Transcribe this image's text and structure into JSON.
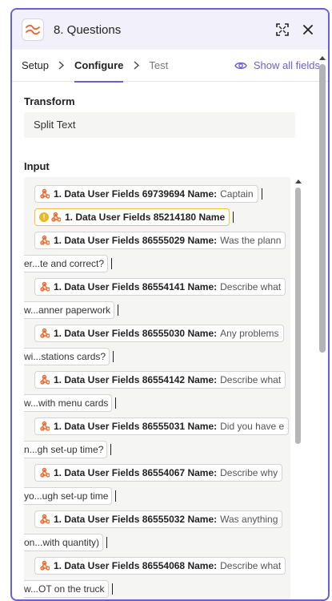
{
  "header": {
    "title": "8. Questions",
    "app_icon": "formatter-wave-icon",
    "expand_icon": "expand-icon",
    "close_icon": "close-icon"
  },
  "tabs": [
    {
      "label": "Setup",
      "state": "done"
    },
    {
      "label": "Configure",
      "state": "active"
    },
    {
      "label": "Test",
      "state": "upcoming"
    }
  ],
  "show_all_fields": "Show all fields",
  "transform": {
    "label": "Transform",
    "value": "Split Text"
  },
  "input": {
    "label": "Input",
    "fields": [
      {
        "name": "1. Data User Fields 69739694 Name:",
        "value": "Captain",
        "continuation": "",
        "warning": false
      },
      {
        "name": "1. Data User Fields 85214180 Name",
        "value": "",
        "continuation": "",
        "warning": true
      },
      {
        "name": "1. Data User Fields 86555029 Name:",
        "value": "Was the plann",
        "continuation": "er...te and correct?",
        "warning": false
      },
      {
        "name": "1. Data User Fields 86554141 Name:",
        "value": "Describe what",
        "continuation": "w...anner paperwork",
        "warning": false
      },
      {
        "name": "1. Data User Fields 86555030 Name:",
        "value": "Any problems",
        "continuation": "wi...stations cards?",
        "warning": false
      },
      {
        "name": "1. Data User Fields 86554142 Name:",
        "value": "Describe what",
        "continuation": "w...with menu cards",
        "warning": false
      },
      {
        "name": "1. Data User Fields 86555031 Name:",
        "value": "Did you have e",
        "continuation": "n...gh set-up time?",
        "warning": false
      },
      {
        "name": "1. Data User Fields 86554067 Name:",
        "value": "Describe why",
        "continuation": "yo...ugh set-up time",
        "warning": false
      },
      {
        "name": "1. Data User Fields 86555032 Name:",
        "value": "Was anything",
        "continuation": "on...with quantity)",
        "warning": false
      },
      {
        "name": "1. Data User Fields 86554068 Name:",
        "value": "Describe what",
        "continuation": "w...OT on the truck",
        "warning": false
      }
    ]
  },
  "colors": {
    "accent": "#6a5fd6",
    "source_icon": "#f0682a",
    "warning": "#e8b923"
  }
}
